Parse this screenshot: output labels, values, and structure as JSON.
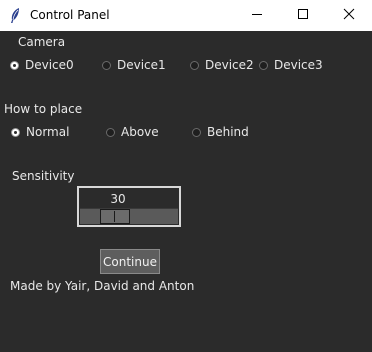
{
  "window": {
    "title": "Control Panel",
    "icons": {
      "app": "feather-icon",
      "minimize": "minimize-icon",
      "maximize": "maximize-icon",
      "close": "close-icon"
    }
  },
  "camera": {
    "label": "Camera",
    "selected": "Device0",
    "options": [
      "Device0",
      "Device1",
      "Device2",
      "Device3"
    ]
  },
  "placement": {
    "label": "How to place",
    "selected": "Normal",
    "options": [
      "Normal",
      "Above",
      "Behind"
    ]
  },
  "sensitivity": {
    "label": "Sensitivity",
    "value": "30",
    "level": 0.3
  },
  "actions": {
    "continue_label": "Continue"
  },
  "footer": {
    "credits": "Made by Yair, David and Anton"
  },
  "colors": {
    "background": "#2b2b2b",
    "text": "#e8e8e8",
    "titlebar": "#ffffff"
  }
}
